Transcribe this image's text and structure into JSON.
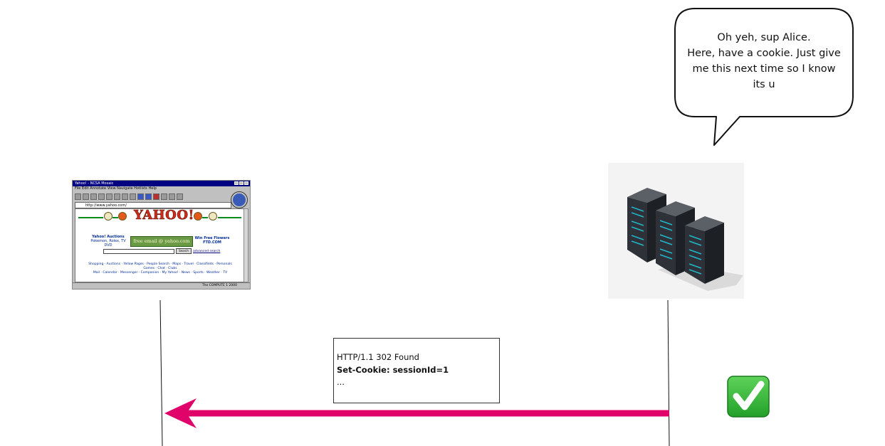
{
  "server_bubble": {
    "lines": [
      "Oh yeh, sup Alice.",
      "Here, have a cookie. Just give",
      "me this next time so I know",
      "its u"
    ]
  },
  "client_browser": {
    "title": "Yahoo! - NCSA Mosaic",
    "menu": "File  Edit  Annotate  View  Navigate  Hotlists  Help",
    "address": "http://www.yahoo.com/",
    "logo": "YAHOO!",
    "left_block": [
      "Yahoo! Auctions",
      "Pokemon, Rolex, TV",
      "DVD"
    ],
    "banner": "free email @ yahoo.com",
    "right_block": [
      "Win Free Flowers",
      "FTD.COM"
    ],
    "search_button": "Search",
    "advanced_search": "advanced search",
    "links_row1": "Shopping · Auctions · Yellow Pages · People Search · Maps · Travel · Classifieds · Personals",
    "links_row2": "Games · Chat · Clubs",
    "links_row3": "Mail · Calendar · Messenger · Companion · My Yahoo! · News · Sports · Weather · TV",
    "status": "The COMPUTE 1 2000"
  },
  "response_message": {
    "status_line": "HTTP/1.1 302 Found",
    "header": "Set-Cookie: sessionId=1",
    "ellipsis": "..."
  },
  "colors": {
    "arrow": "#e0046a",
    "checkmark_bg": "#2fb12f",
    "lifeline": "#111111"
  },
  "icons": [
    "browser-screenshot",
    "server-rack-icon",
    "check-mark-icon"
  ]
}
